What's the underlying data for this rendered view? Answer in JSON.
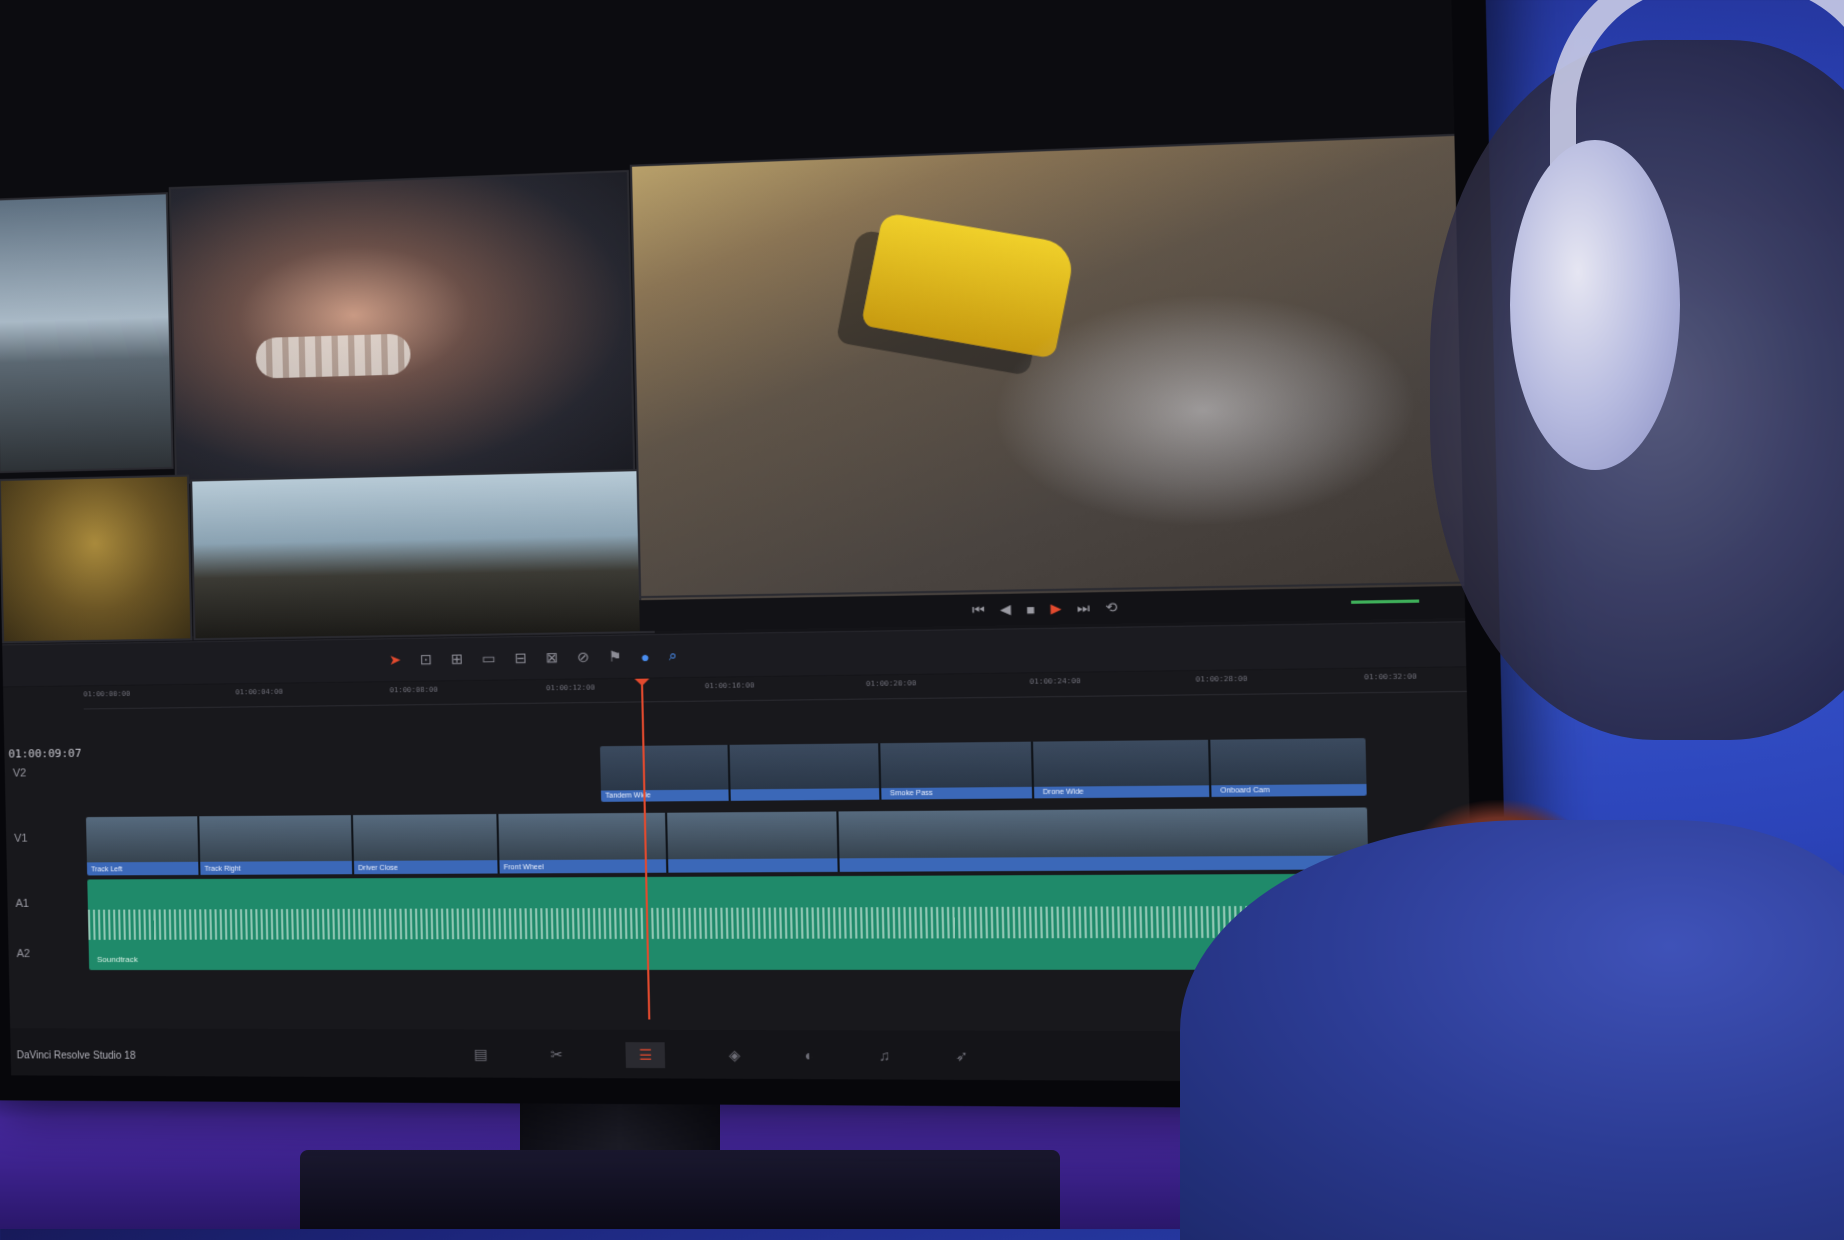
{
  "scene": {
    "description_colors": {
      "accent": "#e34a2e",
      "clip_blue": "#3b68b8",
      "audio_green": "#1f8a6a",
      "backdrop": "#2b43b8"
    }
  },
  "editor": {
    "timecode": "01:00:09:07",
    "status_app": "DaVinci Resolve Studio 18",
    "ruler_ticks": [
      "01:00:00:00",
      "01:00:04:00",
      "01:00:08:00",
      "01:00:12:00",
      "01:00:16:00",
      "01:00:20:00",
      "01:00:24:00",
      "01:00:28:00",
      "01:00:32:00"
    ],
    "tracks": {
      "v2": "V2",
      "v1": "V1",
      "a1": "A1",
      "a2": "A2"
    },
    "audio_clip_label": "Soundtrack",
    "clip_labels": [
      "Track Left",
      "Track Right",
      "Driver Close",
      "Front Wheel",
      "Tandem Wide",
      "Smoke Pass",
      "Drone Wide",
      "Onboard Cam"
    ]
  },
  "icons": {
    "transport": [
      "skip-back-icon",
      "step-back-icon",
      "stop-icon",
      "play-icon",
      "skip-forward-icon",
      "loop-icon"
    ],
    "toolbar": [
      "select-arrow-icon",
      "trim-icon",
      "blade-icon",
      "insert-icon",
      "overwrite-icon",
      "replace-icon",
      "link-icon",
      "flag-icon",
      "marker-icon",
      "zoom-icon"
    ],
    "pages": [
      "media-page-icon",
      "cut-page-icon",
      "edit-page-icon",
      "fusion-page-icon",
      "color-page-icon",
      "fairlight-page-icon",
      "deliver-page-icon"
    ]
  }
}
